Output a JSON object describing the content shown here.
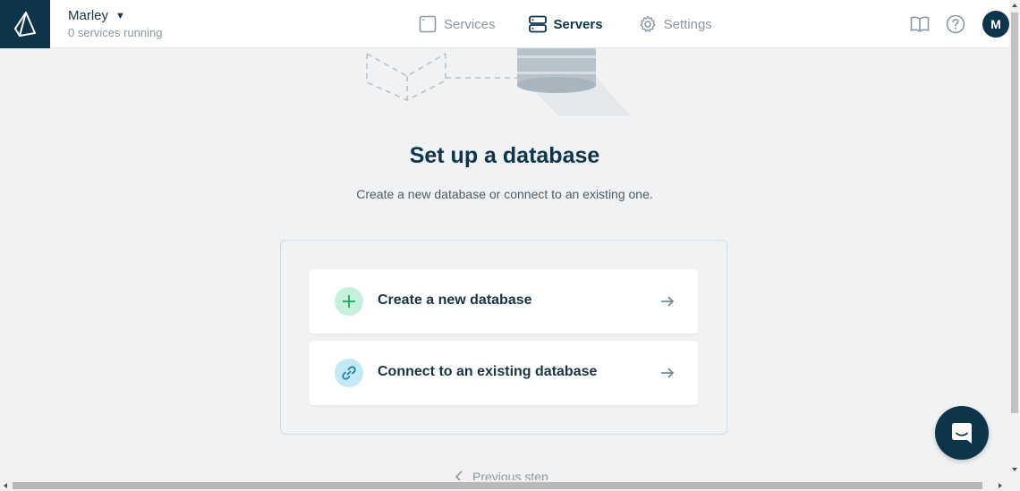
{
  "header": {
    "project_name": "Marley",
    "project_status": "0 services running",
    "nav": {
      "services": "Services",
      "servers": "Servers",
      "settings": "Settings"
    },
    "avatar_initial": "M"
  },
  "main": {
    "title": "Set up a database",
    "subtitle": "Create a new database or connect to an existing one.",
    "options": [
      {
        "label": "Create a new database",
        "icon": "plus-icon"
      },
      {
        "label": "Connect to an existing database",
        "icon": "link-icon"
      }
    ],
    "previous_step": "Previous step"
  },
  "colors": {
    "brand_dark": "#0c344b",
    "background": "#f0f2f4",
    "create_icon_bg": "#c6f0da",
    "connect_icon_bg": "#c2e9f5"
  }
}
